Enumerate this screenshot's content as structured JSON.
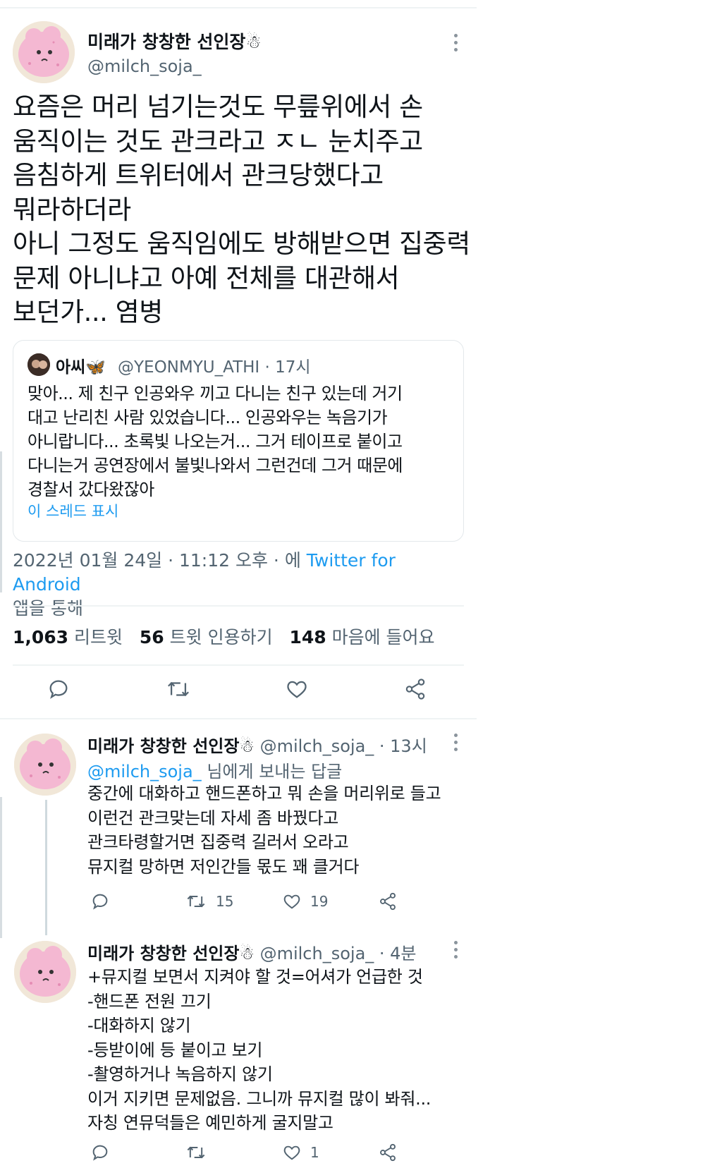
{
  "main_tweet": {
    "display_name": "미래가 창창한 선인장☃",
    "handle": "@milch_soja_",
    "text": "요즘은 머리 넘기는것도 무릎위에서 손\n움직이는 것도 관크라고 ㅈㄴ 눈치주고\n음침하게 트위터에서 관크당했다고\n뭐라하더라\n아니 그정도 움직임에도 방해받으면 집중력\n문제 아니냐고 아예 전체를 대관해서\n보던가... 염병",
    "quote": {
      "name": "아씨🦋",
      "handle_time": "@YEONMYU_ATHI · 17시",
      "text": "맞아... 제 친구 인공와우 끼고 다니는 친구 있는데 거기\n대고 난리친 사람 있었습니다... 인공와우는 녹음기가\n아니랍니다... 초록빛 나오는거... 그거 테이프로 붙이고\n다니는거 공연장에서 불빛나와서 그런건데 그거 때문에\n경찰서 갔다왔잖아",
      "show_thread": "이 스레드 표시"
    },
    "timestamp": "2022년 01월 24일 · 11:12 오후 · 에",
    "source": "Twitter for Android",
    "via": "앱을 통해",
    "stats": {
      "retweets": "1,063",
      "retweets_label": "리트윗",
      "quotes": "56",
      "quotes_label": "트윗 인용하기",
      "likes": "148",
      "likes_label": "마음에 들어요"
    }
  },
  "replies": [
    {
      "display_name": "미래가 창창한 선인장☃",
      "handle_time": "@milch_soja_ · 13시",
      "replying_handle": "@milch_soja_",
      "replying_suffix": "님에게 보내는 답글",
      "text": "중간에 대화하고 핸드폰하고 뭐 손을 머리위로 들고\n이런건 관크맞는데 자세 좀 바꿨다고\n관크타령할거면 집중력 길러서 오라고\n뮤지컬 망하면 저인간들 몫도 꽤 클거다",
      "retweets": "15",
      "likes": "19"
    },
    {
      "display_name": "미래가 창창한 선인장☃",
      "handle_time": "@milch_soja_ · 4분",
      "text": "+뮤지컬 보면서 지켜야 할 것=어셔가 언급한 것\n-핸드폰 전원 끄기\n-대화하지 않기\n-등받이에 등 붙이고 보기\n-촬영하거나 녹음하지 않기\n이거 지키면 문제없음. 그니까 뮤지컬 많이 봐줘...\n자칭 연뮤덕들은 예민하게 굴지말고",
      "likes": "1"
    }
  ],
  "icons": [
    "more-icon",
    "reply-icon",
    "retweet-icon",
    "like-icon",
    "share-icon"
  ],
  "colors": {
    "link_blue": "#1d9bf0",
    "secondary_text": "#536471",
    "avatar_pink": "#f4b8d2"
  }
}
